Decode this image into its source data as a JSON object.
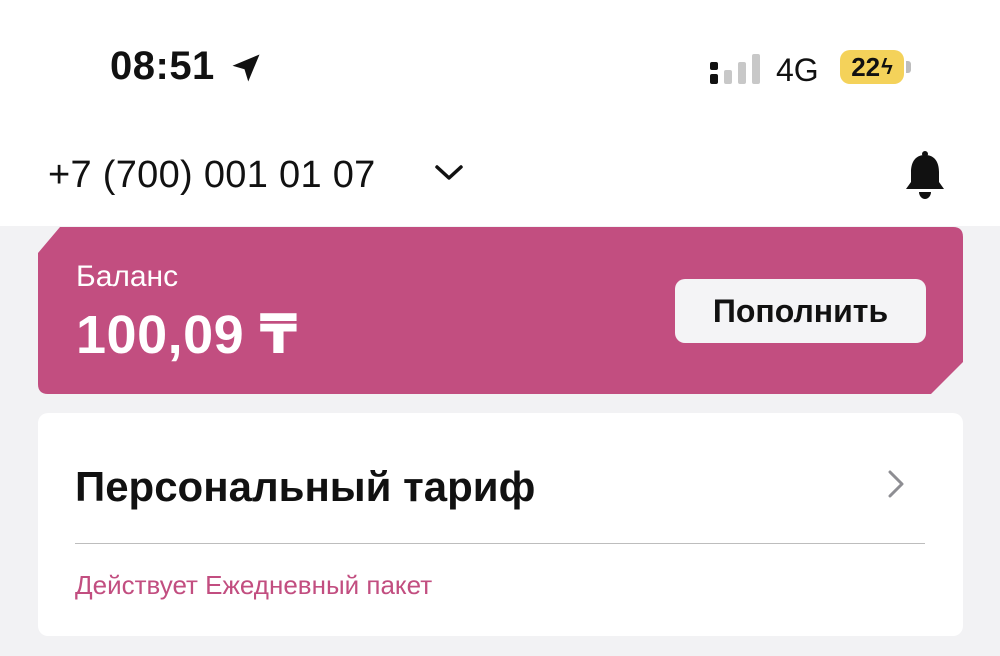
{
  "status_bar": {
    "time": "08:51",
    "network": "4G",
    "battery": "22"
  },
  "header": {
    "phone_number": "+7 (700) 001 01 07"
  },
  "balance": {
    "label": "Баланс",
    "value": "100,09 ₸",
    "topup_label": "Пополнить"
  },
  "tariff": {
    "title": "Персональный тариф",
    "status": "Действует Ежедневный пакет"
  },
  "colors": {
    "accent": "#c24e80",
    "battery": "#f4d25a"
  },
  "icons": [
    "location-arrow-icon",
    "signal-icon",
    "chevron-down-icon",
    "bell-icon",
    "chevron-right-icon",
    "bolt-icon"
  ]
}
